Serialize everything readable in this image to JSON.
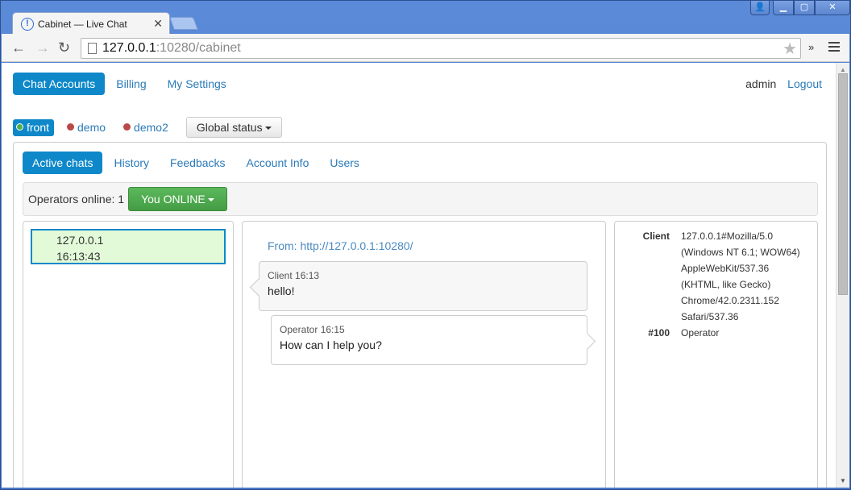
{
  "browser": {
    "tab_title": "Cabinet — Live Chat",
    "tab_icon": "!",
    "url_host": "127.0.0.1",
    "url_rest": ":10280/cabinet",
    "ext_label": "»"
  },
  "topnav": {
    "items": [
      {
        "label": "Chat Accounts",
        "active": true
      },
      {
        "label": "Billing",
        "active": false
      },
      {
        "label": "My Settings",
        "active": false
      }
    ],
    "user": "admin",
    "logout": "Logout"
  },
  "accounts": {
    "items": [
      {
        "label": "front",
        "status": "online",
        "active": true
      },
      {
        "label": "demo",
        "status": "offline",
        "active": false
      },
      {
        "label": "demo2",
        "status": "offline",
        "active": false
      }
    ],
    "global_status": "Global status"
  },
  "subnav": {
    "items": [
      {
        "label": "Active chats",
        "active": true
      },
      {
        "label": "History",
        "active": false
      },
      {
        "label": "Feedbacks",
        "active": false
      },
      {
        "label": "Account Info",
        "active": false
      },
      {
        "label": "Users",
        "active": false
      }
    ]
  },
  "operators": {
    "label": "Operators online: 1",
    "status_button": "You ONLINE"
  },
  "chats": [
    {
      "ip": "127.0.0.1",
      "time": "16:13:43"
    }
  ],
  "conversation": {
    "from": "From: http://127.0.0.1:10280/",
    "messages": [
      {
        "meta": "Client 16:13",
        "text": "hello!"
      },
      {
        "meta": "Operator 16:15",
        "text": "How can I help you?"
      }
    ]
  },
  "client_info": [
    {
      "key": "Client",
      "lines": [
        "127.0.0.1#Mozilla/5.0",
        "(Windows NT 6.1; WOW64)",
        "AppleWebKit/537.36",
        "(KHTML, like Gecko)",
        "Chrome/42.0.2311.152",
        "Safari/537.36"
      ]
    },
    {
      "key": "#100",
      "lines": [
        "Operator"
      ]
    }
  ]
}
